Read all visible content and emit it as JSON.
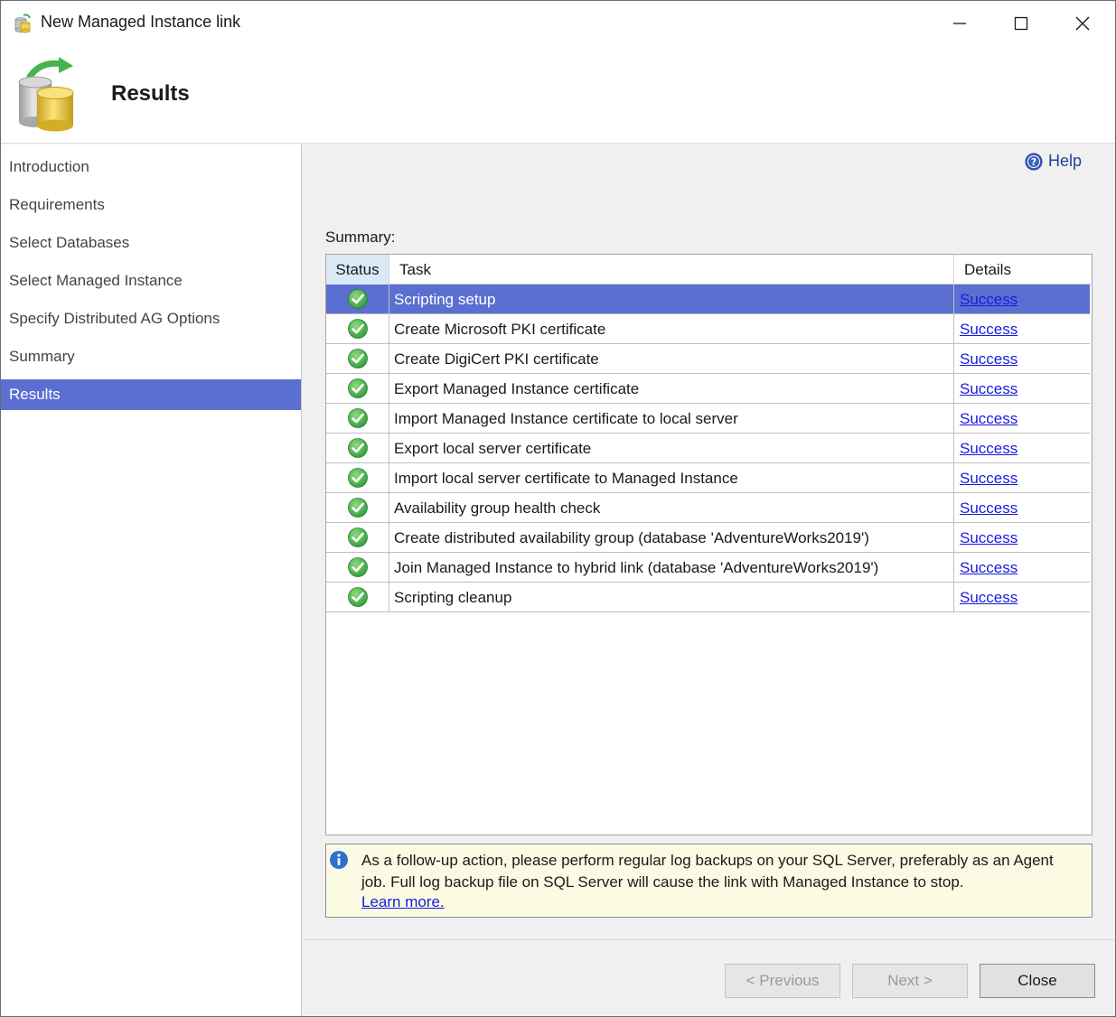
{
  "window": {
    "title": "New Managed Instance link"
  },
  "header": {
    "title": "Results"
  },
  "sidebar": {
    "items": [
      {
        "label": "Introduction"
      },
      {
        "label": "Requirements"
      },
      {
        "label": "Select Databases"
      },
      {
        "label": "Select Managed Instance"
      },
      {
        "label": "Specify Distributed AG Options"
      },
      {
        "label": "Summary"
      },
      {
        "label": "Results",
        "active": true
      }
    ]
  },
  "help": {
    "label": "Help"
  },
  "summary": {
    "label": "Summary:",
    "columns": {
      "status": "Status",
      "task": "Task",
      "details": "Details"
    },
    "rows": [
      {
        "status_icon": "success-check-icon",
        "task": "Scripting setup",
        "details": "Success",
        "selected": true
      },
      {
        "status_icon": "success-check-icon",
        "task": "Create Microsoft PKI certificate",
        "details": "Success"
      },
      {
        "status_icon": "success-check-icon",
        "task": "Create DigiCert PKI certificate",
        "details": "Success"
      },
      {
        "status_icon": "success-check-icon",
        "task": "Export Managed Instance certificate",
        "details": "Success"
      },
      {
        "status_icon": "success-check-icon",
        "task": "Import Managed Instance certificate to local server",
        "details": "Success"
      },
      {
        "status_icon": "success-check-icon",
        "task": "Export local server certificate",
        "details": "Success"
      },
      {
        "status_icon": "success-check-icon",
        "task": "Import local server certificate to Managed Instance",
        "details": "Success"
      },
      {
        "status_icon": "success-check-icon",
        "task": "Availability group health check",
        "details": "Success"
      },
      {
        "status_icon": "success-check-icon",
        "task": "Create distributed availability group (database 'AdventureWorks2019')",
        "details": "Success"
      },
      {
        "status_icon": "success-check-icon",
        "task": "Join Managed Instance to hybrid link (database 'AdventureWorks2019')",
        "details": "Success"
      },
      {
        "status_icon": "success-check-icon",
        "task": "Scripting cleanup",
        "details": "Success"
      }
    ]
  },
  "info": {
    "text": "As a follow-up action, please perform regular log backups on your SQL Server, preferably as an Agent job. Full log backup file on SQL Server will cause the link with Managed Instance to stop.",
    "link": "Learn more."
  },
  "buttons": {
    "previous": "< Previous",
    "next": "Next >",
    "close": "Close"
  },
  "colors": {
    "selection": "#5b6fd1",
    "link": "#1a1adf",
    "info_background": "#fbfbe3",
    "success_green": "#3da843"
  }
}
